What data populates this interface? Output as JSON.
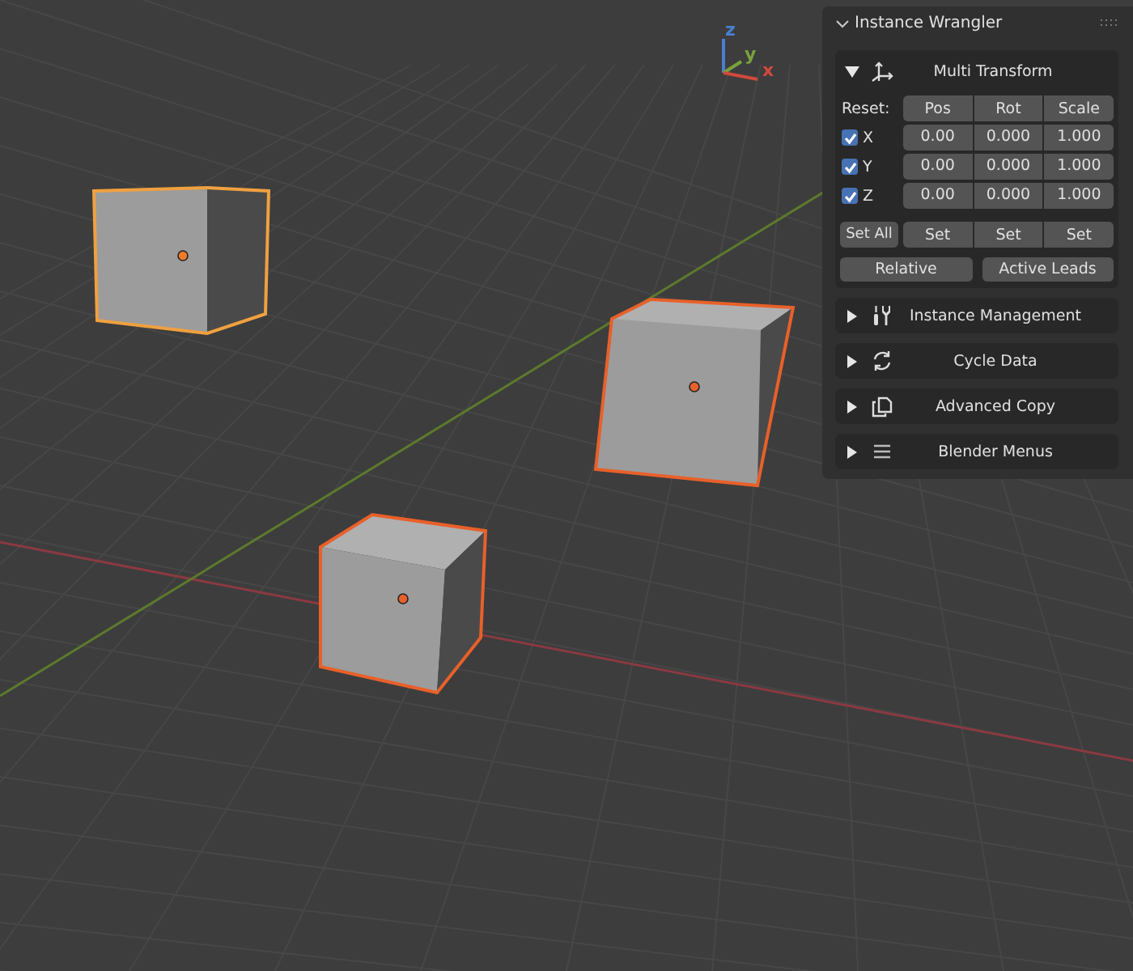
{
  "gizmo": {
    "axes": [
      {
        "kind": "z",
        "label": "z"
      },
      {
        "kind": "y",
        "label": "y"
      },
      {
        "kind": "x",
        "label": "x"
      }
    ]
  },
  "panel": {
    "title": "Instance Wrangler",
    "expanded": true
  },
  "multi_transform": {
    "title": "Multi Transform",
    "expanded": true,
    "reset_label": "Reset:",
    "columns": [
      "Pos",
      "Rot",
      "Scale"
    ],
    "axes": [
      {
        "label": "X",
        "checked": true,
        "values": [
          "0.00",
          "0.000",
          "1.000"
        ]
      },
      {
        "label": "Y",
        "checked": true,
        "values": [
          "0.00",
          "0.000",
          "1.000"
        ]
      },
      {
        "label": "Z",
        "checked": true,
        "values": [
          "0.00",
          "0.000",
          "1.000"
        ]
      }
    ],
    "set_all": "Set All",
    "set_buttons": [
      "Set",
      "Set",
      "Set"
    ],
    "buttons": [
      "Relative",
      "Active Leads"
    ]
  },
  "sections": [
    {
      "title": "Instance Management",
      "kind": "tools",
      "expanded": false
    },
    {
      "title": "Cycle Data",
      "kind": "cycle",
      "expanded": false
    },
    {
      "title": "Advanced Copy",
      "kind": "copy",
      "expanded": false
    },
    {
      "title": "Blender Menus",
      "kind": "menu",
      "expanded": false
    }
  ]
}
